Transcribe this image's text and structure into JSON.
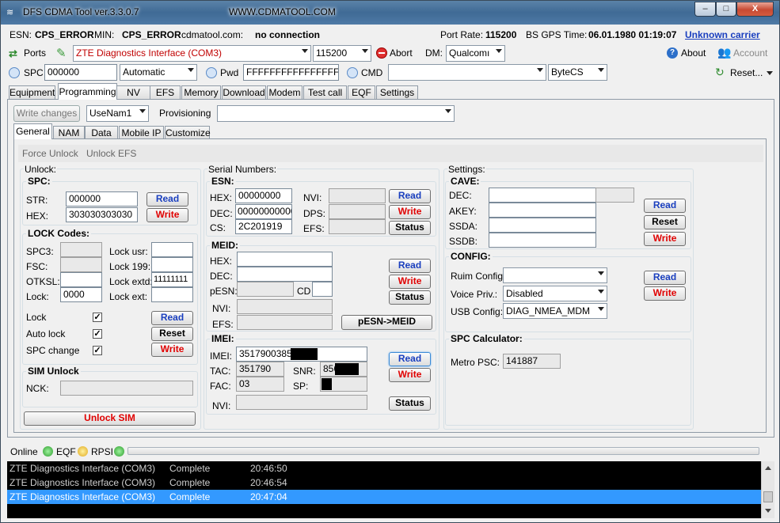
{
  "window": {
    "title": "DFS CDMA Tool ver.3.3.0.7",
    "url": "WWW.CDMATOOL.COM",
    "min": "–",
    "max": "□",
    "close": "X"
  },
  "status": {
    "esn_label": "ESN:",
    "esn_value": "CPS_ERROR",
    "min_label": "MIN:",
    "min_value": "CPS_ERROR",
    "site_label": "cdmatool.com:",
    "site_value": "no connection",
    "port_rate_label": "Port Rate:",
    "port_rate_value": "115200",
    "gps_label": "BS GPS Time:",
    "gps_value": "06.01.1980 01:19:07",
    "carrier": "Unknown carrier"
  },
  "toolbar1": {
    "ports": "Ports",
    "interface": "ZTE Diagnostics Interface (COM3)",
    "baud": "115200",
    "abort": "Abort",
    "dm_label": "DM:",
    "dm_value": "Qualcomı",
    "about": "About",
    "account": "Account"
  },
  "toolbar2": {
    "spc_label": "SPC",
    "spc_value": "000000",
    "mode": "Automatic",
    "pwd_label": "Pwd",
    "pwd_value": "FFFFFFFFFFFFFFFF",
    "cmd_label": "CMD",
    "cmd_value": "",
    "bytecs": "ByteCS",
    "reset": "Reset..."
  },
  "main_tabs": [
    "Equipment",
    "Programming",
    "NV",
    "EFS",
    "Memory",
    "Download",
    "Modem",
    "Test call",
    "EQF",
    "Settings"
  ],
  "prog_bar": {
    "write_changes": "Write changes",
    "usenam": "UseNam1",
    "provisioning_label": "Provisioning",
    "provisioning_value": ""
  },
  "sub_tabs": [
    "General",
    "NAM",
    "Data",
    "Mobile IP",
    "Customize"
  ],
  "links": {
    "force_unlock": "Force Unlock",
    "unlock_efs": "Unlock EFS"
  },
  "unlock": {
    "title": "Unlock:",
    "spc_title": "SPC:",
    "str_label": "STR:",
    "str_value": "000000",
    "hex_label": "HEX:",
    "hex_value": "303030303030",
    "read": "Read",
    "write": "Write",
    "lock_title": "LOCK Codes:",
    "spc3": "SPC3:",
    "fsc": "FSC:",
    "otksl": "OTKSL:",
    "lock": "Lock:",
    "lock_value": "0000",
    "lock_usr": "Lock usr:",
    "lock199": "Lock 199:",
    "lock_extd": "Lock extd:",
    "lock_extd_value": "11111111",
    "lock_ext": "Lock ext:",
    "chk_lock": "Lock",
    "chk_autolock": "Auto lock",
    "chk_spcchange": "SPC change",
    "check": "✓",
    "lc_read": "Read",
    "lc_reset": "Reset",
    "lc_write": "Write",
    "sim_title": "SIM Unlock",
    "nck": "NCK:",
    "unlock_sim": "Unlock SIM"
  },
  "serial": {
    "title": "Serial Numbers:",
    "esn_title": "ESN:",
    "hex": "HEX:",
    "hex_value": "00000000",
    "dec": "DEC:",
    "dec_value": "00000000000",
    "cs": "CS:",
    "cs_value": "2C201919",
    "nvi": "NVI:",
    "dps": "DPS:",
    "efs": "EFS:",
    "read": "Read",
    "write": "Write",
    "status": "Status",
    "meid_title": "MEID:",
    "m_hex": "HEX:",
    "m_dec": "DEC:",
    "pesn": "pESN:",
    "cd": "CD",
    "m_nvi": "NVI:",
    "m_efs": "EFS:",
    "m_read": "Read",
    "m_write": "Write",
    "m_status": "Status",
    "pesn_meid": "pESN->MEID",
    "imei_title": "IMEI:",
    "imei": "IMEI:",
    "imei_value": "35179003856",
    "tac": "TAC:",
    "tac_value": "351790",
    "snr": "SNR:",
    "snr_value": "856",
    "fac": "FAC:",
    "fac_value": "03",
    "sp": "SP:",
    "i_nvi": "NVI:",
    "i_read": "Read",
    "i_write": "Write",
    "i_status": "Status"
  },
  "settings": {
    "title": "Settings:",
    "cave_title": "CAVE:",
    "dec": "DEC:",
    "akey": "AKEY:",
    "ssda": "SSDA:",
    "ssdb": "SSDB:",
    "read": "Read",
    "reset": "Reset",
    "write": "Write",
    "config_title": "CONFIG:",
    "ruim": "Ruim Config:",
    "ruim_value": "",
    "voice": "Voice Priv.:",
    "voice_value": "Disabled",
    "usb": "USB Config:",
    "usb_value": "DIAG_NMEA_MDM",
    "c_read": "Read",
    "c_write": "Write",
    "spc_calc_title": "SPC Calculator:",
    "metro": "Metro PSC:",
    "metro_value": "141887"
  },
  "bottom": {
    "online": "Online",
    "eqf": "EQF",
    "rpsi": "RPSI"
  },
  "log": [
    {
      "device": "ZTE Diagnostics Interface (COM3)",
      "status": "Complete",
      "time": "20:46:50"
    },
    {
      "device": "ZTE Diagnostics Interface (COM3)",
      "status": "Complete",
      "time": "20:46:54"
    },
    {
      "device": "ZTE Diagnostics Interface (COM3)",
      "status": "Complete",
      "time": "20:47:04"
    }
  ],
  "colors": {
    "accent": "#3399ff",
    "red": "#e00000",
    "blue": "#1a3fbf"
  }
}
